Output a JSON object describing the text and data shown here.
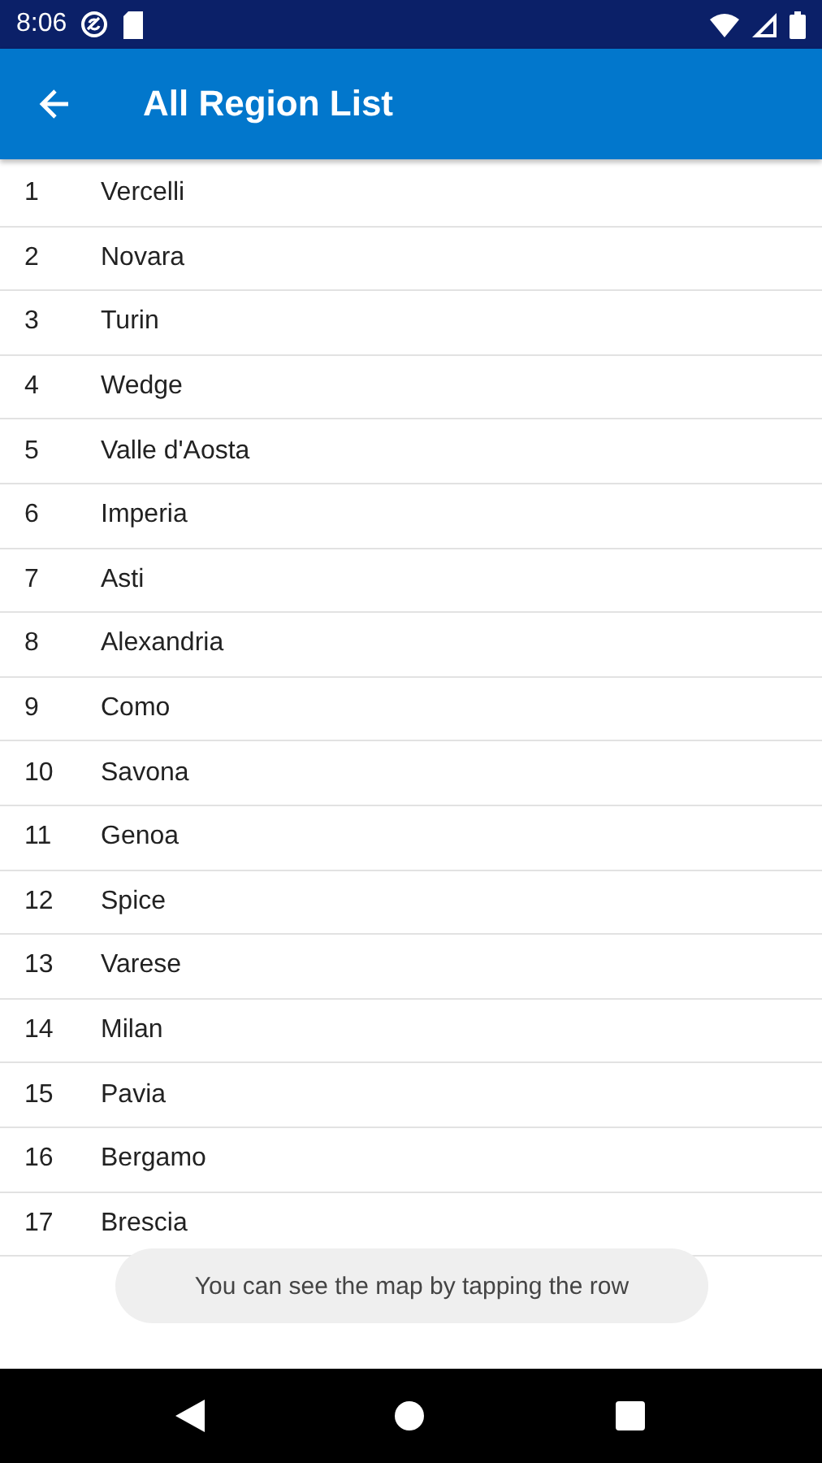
{
  "status_bar": {
    "time": "8:06"
  },
  "app_bar": {
    "title": "All Region List"
  },
  "regions": [
    {
      "number": "1",
      "name": "Vercelli"
    },
    {
      "number": "2",
      "name": "Novara"
    },
    {
      "number": "3",
      "name": "Turin"
    },
    {
      "number": "4",
      "name": "Wedge"
    },
    {
      "number": "5",
      "name": "Valle d'Aosta"
    },
    {
      "number": "6",
      "name": "Imperia"
    },
    {
      "number": "7",
      "name": "Asti"
    },
    {
      "number": "8",
      "name": "Alexandria"
    },
    {
      "number": "9",
      "name": "Como"
    },
    {
      "number": "10",
      "name": "Savona"
    },
    {
      "number": "11",
      "name": "Genoa"
    },
    {
      "number": "12",
      "name": "Spice"
    },
    {
      "number": "13",
      "name": "Varese"
    },
    {
      "number": "14",
      "name": "Milan"
    },
    {
      "number": "15",
      "name": "Pavia"
    },
    {
      "number": "16",
      "name": "Bergamo"
    },
    {
      "number": "17",
      "name": "Brescia"
    }
  ],
  "toast": {
    "text": "You can see the map by tapping the row"
  }
}
